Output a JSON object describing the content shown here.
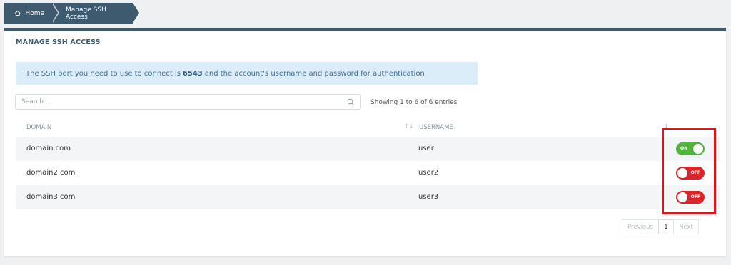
{
  "breadcrumb": {
    "home_label": "Home",
    "current_label": "Manage SSH Access"
  },
  "panel": {
    "title": "MANAGE SSH ACCESS"
  },
  "info": {
    "prefix": "The SSH port you need to use to connect is",
    "port": "6543",
    "suffix": "and the account's username and password for authentication"
  },
  "search": {
    "placeholder": "Search..."
  },
  "showing_text": "Showing 1 to 6 of 6 entries",
  "table": {
    "headers": {
      "domain": "DOMAIN",
      "username": "USERNAME"
    },
    "rows": [
      {
        "domain": "domain.com",
        "username": "user",
        "ssh": "ON"
      },
      {
        "domain": "domain2.com",
        "username": "user2",
        "ssh": "OFF"
      },
      {
        "domain": "domain3.com",
        "username": "user3",
        "ssh": "OFF"
      }
    ]
  },
  "pagination": {
    "previous": "Previous",
    "page": "1",
    "next": "Next"
  },
  "colors": {
    "brand": "#3d5a6e",
    "toggle_on": "#52b43a",
    "toggle_off": "#d9262b",
    "highlight": "#e0151b",
    "info_bg": "#dcedfa"
  },
  "icons": [
    "home-icon",
    "search-icon",
    "sort-icon"
  ]
}
